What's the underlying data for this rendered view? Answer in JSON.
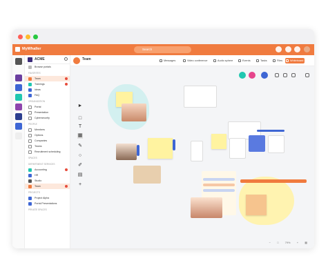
{
  "app": {
    "workspace": "MyWhaller",
    "org": "ACME",
    "search_placeholder": "Search"
  },
  "sidebar": {
    "browse": "Browse portals",
    "sections": [
      {
        "title": "FAVORITES",
        "items": [
          "Team",
          "Trainings",
          "Ideas",
          "FAQ"
        ]
      },
      {
        "title": "ORGANIZATION",
        "items": [
          "Portal",
          "Presentation",
          "Cybersecurity"
        ]
      },
      {
        "title": "PEOPLE",
        "items": [
          "Members",
          "Options",
          "Companies",
          "Teams",
          "Recruitment scheduling"
        ]
      },
      {
        "title": "SPACES",
        "items": []
      },
      {
        "title": "DEPARTMENT SERVICES",
        "items": [
          "Accounting",
          "HR",
          "Studio",
          "Team"
        ]
      },
      {
        "title": "PROJECTS",
        "items": [
          "Project Alpha",
          "Portal Presentations"
        ]
      },
      {
        "title": "PRIVATE SPACES",
        "items": []
      }
    ]
  },
  "board": {
    "title": "Team",
    "tabs": [
      "Messages",
      "Video conference",
      "Audio sphere",
      "Events",
      "Tasks",
      "Files",
      "Whiteboard"
    ],
    "zoom": "79%"
  },
  "colors": {
    "accent": "#f07b3f",
    "teal": "#21c7b0",
    "pink": "#e6458c",
    "blue": "#3e66d4",
    "yellow": "#fff3a0"
  }
}
